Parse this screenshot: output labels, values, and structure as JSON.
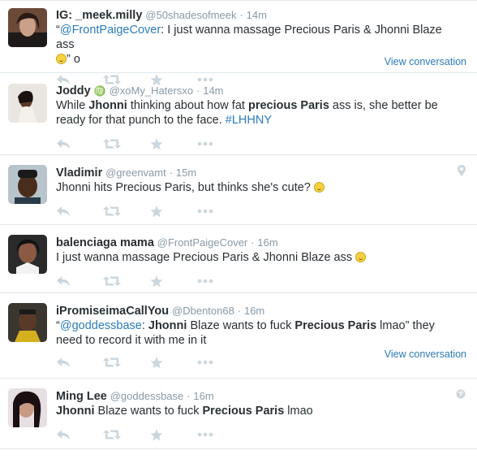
{
  "colors": {
    "link": "#2b7bb9",
    "muted": "#8899a6",
    "text": "#292f33",
    "divider": "#e1e8ed",
    "icon": "#ccd6dd"
  },
  "actions": {
    "reply_icon": "reply-icon",
    "retweet_icon": "retweet-icon",
    "favorite_icon": "star-icon",
    "more_icon": "more-dots-icon"
  },
  "tweets": [
    {
      "name": "IG: _meek.milly",
      "handle": "@50shadesofmeek",
      "sep": "·",
      "time": "14m",
      "text_parts": [
        "“",
        "@FrontPaigeCover",
        ": I just wanna massage Precious Paris & Jhonni Blaze ass ",
        "” o"
      ],
      "view_conversation": "View conversation"
    },
    {
      "name": "Joddy",
      "symbol": "♍",
      "handle": "@xoMy_Hatersxo",
      "sep": "·",
      "time": "14m",
      "text_parts": [
        "While ",
        "Jhonni",
        " thinking about how fat ",
        "precious Paris",
        " ass is, she better be ready for that punch to the face. ",
        "#LHHNY"
      ]
    },
    {
      "name": "Vladimir",
      "handle": "@greenvamt",
      "sep": "·",
      "time": "15m",
      "text_parts": [
        "Jhonni hits Precious Paris, but thinks she's cute? "
      ],
      "corner_icon": "location-pin-icon"
    },
    {
      "name": "balenciaga mama",
      "handle": "@FrontPaigeCover",
      "sep": "·",
      "time": "16m",
      "text_parts": [
        "I just wanna massage Precious Paris & Jhonni Blaze ass "
      ]
    },
    {
      "name": "iPromiseimaCallYou",
      "handle": "@Dbenton68",
      "sep": "·",
      "time": "16m",
      "text_parts": [
        "“",
        "@goddessbase",
        ": ",
        "Jhonni",
        " Blaze wants to fuck ",
        "Precious Paris",
        " lmao” they need to record it with me in it"
      ],
      "view_conversation": "View conversation"
    },
    {
      "name": "Ming Lee",
      "handle": "@goddessbase",
      "sep": "·",
      "time": "16m",
      "text_parts": [
        "Jhonni",
        " Blaze wants to fuck ",
        "Precious Paris",
        " lmao"
      ],
      "corner_icon": "globe-icon"
    }
  ]
}
